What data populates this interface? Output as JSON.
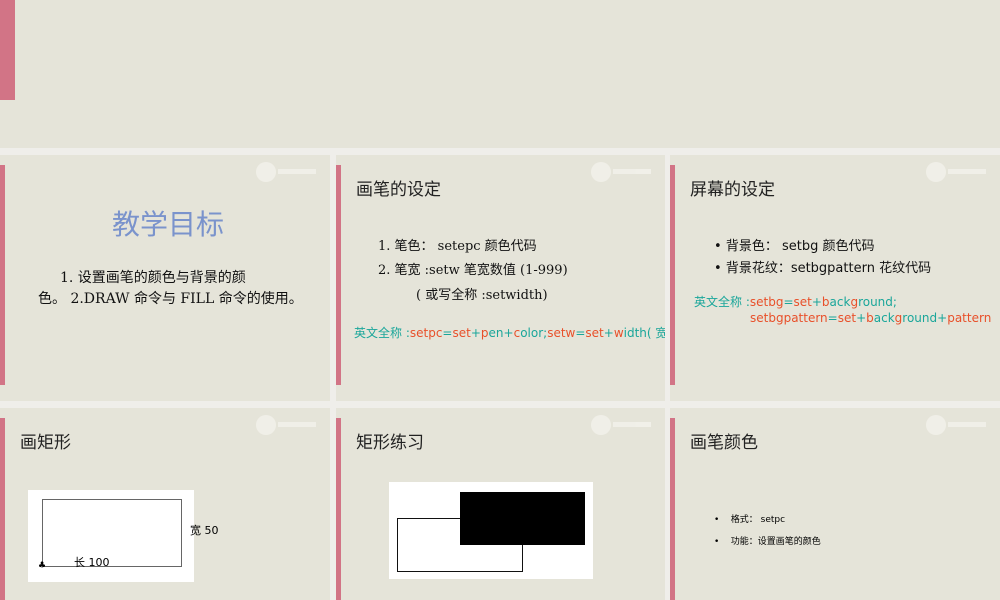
{
  "slides": [
    {
      "id": "top-partial"
    },
    {
      "title": "教学目标",
      "lines": [
        "1. 设置画笔的颜色与背景的颜",
        "色。 2.DRAW 命令与 FILL 命令的使用。"
      ]
    },
    {
      "title": "画笔的设定",
      "lines": [
        "1. 笔色：  setepc   颜色代码",
        "2. 笔宽 :setw   笔宽数值 (1-999)",
        "( 或写全称 :setwidth)"
      ],
      "note_label": "英文全称 :",
      "note": [
        [
          "setpc",
          "#e8502a"
        ],
        [
          "=",
          "#1aa69a"
        ],
        [
          "set",
          "#e8502a"
        ],
        [
          "+",
          "#1aa69a"
        ],
        [
          "p",
          "#e8502a"
        ],
        [
          "en",
          "#1aa69a"
        ],
        [
          "+",
          "#1aa69a"
        ],
        [
          "c",
          "#e8502a"
        ],
        [
          "olor;",
          "#1aa69a"
        ],
        [
          "setw",
          "#e8502a"
        ],
        [
          "=",
          "#1aa69a"
        ],
        [
          "set",
          "#e8502a"
        ],
        [
          "+",
          "#1aa69a"
        ],
        [
          "w",
          "#e8502a"
        ],
        [
          "idth( 宽 )",
          "#1aa69a"
        ]
      ]
    },
    {
      "title": "屏幕的设定",
      "bullets": [
        "背景色：  setbg   颜色代码",
        "背景花纹：setbgpattern   花纹代码"
      ],
      "note_label": "英文全称 :",
      "note": [
        [
          "setbg",
          "#e8502a"
        ],
        [
          "=",
          "#1aa69a"
        ],
        [
          "set",
          "#e8502a"
        ],
        [
          "+",
          "#1aa69a"
        ],
        [
          "b",
          "#e8502a"
        ],
        [
          "ack",
          "#1aa69a"
        ],
        [
          "g",
          "#e8502a"
        ],
        [
          "round;",
          "#1aa69a"
        ]
      ],
      "note2": [
        [
          "setbgpattern",
          "#e8502a"
        ],
        [
          "=",
          "#1aa69a"
        ],
        [
          "set",
          "#e8502a"
        ],
        [
          "+",
          "#1aa69a"
        ],
        [
          "b",
          "#e8502a"
        ],
        [
          "ack",
          "#1aa69a"
        ],
        [
          "g",
          "#e8502a"
        ],
        [
          "round",
          "#1aa69a"
        ],
        [
          "+",
          "#1aa69a"
        ],
        [
          "pattern",
          "#e8502a"
        ]
      ]
    },
    {
      "title": "画矩形",
      "width_label": "宽 50",
      "length_label": "长 100"
    },
    {
      "title": "矩形练习"
    },
    {
      "title": "画笔颜色",
      "bullets": [
        "格式： setpc",
        "功能：设置画笔的颜色"
      ]
    }
  ]
}
